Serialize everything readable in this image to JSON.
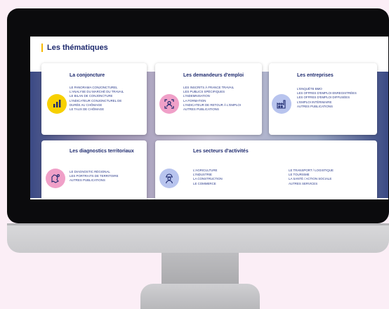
{
  "page_title": "Les thématiques",
  "colors": {
    "accent": "#f5b800",
    "title": "#1e2a6e",
    "link": "#2a3a8a"
  },
  "cards": {
    "conjoncture": {
      "title": "La conjoncture",
      "icon": "bar-chart-icon",
      "icon_color": "#f7d000",
      "links": [
        "LE PANORAMA CONJONCTUREL",
        "L'ANALYSE DU MARCHÉ DU TRAVAIL",
        "LE BILAN DE CONJONCTURE",
        "L'INDICATEUR CONJONCTUREL DE",
        "DURÉE AU CHÔMAGE",
        "LE TAUX DE CHÔMAGE"
      ]
    },
    "demandeurs": {
      "title": "Les demandeurs d'emploi",
      "icon": "person-scan-icon",
      "icon_color": "#f0a0c8",
      "links": [
        "LES INSCRITS À FRANCE TRAVAIL",
        "LES PUBLICS SPÉCIFIQUES",
        "L'INDEMNISATION",
        "LA FORMATION",
        "L'INDICATEUR DE RETOUR À L'EMPLOI",
        "AUTRES PUBLICATIONS"
      ]
    },
    "entreprises": {
      "title": "Les entreprises",
      "icon": "factory-icon",
      "icon_color": "#b8c4ee",
      "links": [
        "L'ENQUÊTE BMO",
        "LES OFFRES D'EMPLOI ENREGISTRÉES",
        "LES OFFRES D'EMPLOI DIFFUSÉES",
        "L'EMPLOI INTÉRIMAIRE",
        "AUTRES PUBLICATIONS"
      ]
    },
    "diagnostics": {
      "title": "Les diagnostics territoriaux",
      "icon": "map-icon",
      "icon_color": "#f0a0c8",
      "links": [
        "LE DIAGNOSTIC RÉGIONAL",
        "LES PORTRAITS DE TERRITOIRE",
        "AUTRES PUBLICATIONS"
      ]
    },
    "secteurs": {
      "title": "Les secteurs d'activités",
      "icon": "worker-icon",
      "icon_color": "#b8c4ee",
      "links_left": [
        "L'AGRICULTURE",
        "L'INDUSTRIE",
        "LA CONSTRUCTION",
        "LE COMMERCE"
      ],
      "links_right": [
        "LE TRANSPORT / LOGISTIQUE",
        "LE TOURISME",
        "LA SANTÉ / ACTION SOCIALE",
        "AUTRES SERVICES"
      ]
    }
  }
}
